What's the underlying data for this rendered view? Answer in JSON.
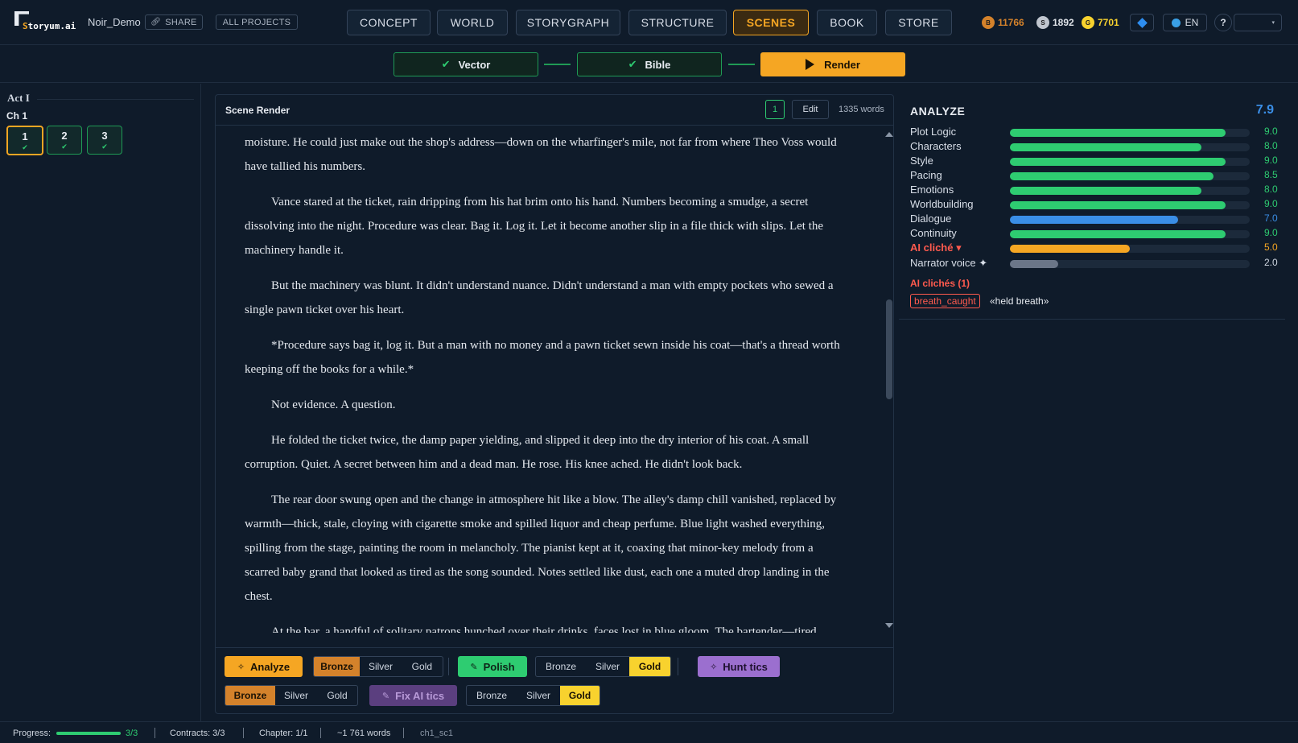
{
  "app": {
    "logo_text": "Storyum.ai",
    "project_name": "Noir_Demo",
    "share_label": "SHARE",
    "all_projects_label": "ALL PROJECTS"
  },
  "nav": {
    "tabs": [
      {
        "label": "CONCEPT",
        "active": false
      },
      {
        "label": "WORLD",
        "active": false
      },
      {
        "label": "STORYGRAPH",
        "active": false
      },
      {
        "label": "STRUCTURE",
        "active": false
      },
      {
        "label": "SCENES",
        "active": true
      },
      {
        "label": "BOOK",
        "active": false
      },
      {
        "label": "STORE",
        "active": false
      }
    ]
  },
  "wallet": {
    "bronze": {
      "symbol": "B",
      "value": "11766",
      "color": "#d4822b"
    },
    "silver": {
      "symbol": "S",
      "value": "1892",
      "color": "#c0c6cf"
    },
    "gold": {
      "symbol": "G",
      "value": "7701",
      "color": "#f8d22e"
    }
  },
  "header_controls": {
    "language": "EN",
    "help": "?"
  },
  "pipeline": {
    "steps": [
      {
        "label": "Vector",
        "status": "done"
      },
      {
        "label": "Bible",
        "status": "done"
      },
      {
        "label": "Render",
        "status": "current"
      }
    ]
  },
  "sidebar": {
    "act": "Act I",
    "chapter": "Ch 1",
    "scenes": [
      {
        "label": "1",
        "selected": true
      },
      {
        "label": "2",
        "selected": false
      },
      {
        "label": "3",
        "selected": false
      }
    ]
  },
  "editor": {
    "title": "Scene Render",
    "version": "1",
    "edit_label": "Edit",
    "word_count": "1335 words",
    "paragraphs": [
      "He opened it in his palm. A pawn ticket. The typed numbers were already feathering, blurring into pale paper from the moisture. He could just make out the shop's address—down on the wharfinger's mile, not far from where Theo Voss would have tallied his numbers.",
      "Vance stared at the ticket, rain dripping from his hat brim onto his hand. Numbers becoming a smudge, a secret dissolving into the night. Procedure was clear. Bag it. Log it. Let it become another slip in a file thick with slips. Let the machinery handle it.",
      "But the machinery was blunt. It didn't understand nuance. Didn't understand a man with empty pockets who sewed a single pawn ticket over his heart.",
      "*Procedure says bag it, log it. But a man with no money and a pawn ticket sewn inside his coat—that's a thread worth keeping off the books for a while.*",
      "Not evidence. A question.",
      "He folded the ticket twice, the damp paper yielding, and slipped it deep into the dry interior of his coat. A small corruption. Quiet. A secret between him and a dead man. He rose. His knee ached. He didn't look back.",
      "The rear door swung open and the change in atmosphere hit like a blow. The alley's damp chill vanished, replaced by warmth—thick, stale, cloying with cigarette smoke and spilled liquor and cheap perfume. Blue light washed everything, spilling from the stage, painting the room in melancholy. The pianist kept at it, coaxing that minor-key melody from a scarred baby grand that looked as tired as the song sounded. Notes settled like dust, each one a muted drop landing in the chest.",
      "At the bar, a handful of solitary patrons hunched over their drinks, faces lost in blue gloom. The bartender—tired"
    ]
  },
  "tools": {
    "analyze_label": "Analyze",
    "polish_label": "Polish",
    "hunt_tics_label": "Hunt tics",
    "fix_ai_tics_label": "Fix AI tics",
    "tier_bronze": "Bronze",
    "tier_silver": "Silver",
    "tier_gold": "Gold"
  },
  "analysis": {
    "title": "ANALYZE",
    "overall": "7.9",
    "metrics": [
      {
        "label": "Plot Logic",
        "value": "9.0",
        "score": 9.0,
        "color": "#2ecc71"
      },
      {
        "label": "Characters",
        "value": "8.0",
        "score": 8.0,
        "color": "#2ecc71"
      },
      {
        "label": "Style",
        "value": "9.0",
        "score": 9.0,
        "color": "#2ecc71"
      },
      {
        "label": "Pacing",
        "value": "8.5",
        "score": 8.5,
        "color": "#2ecc71"
      },
      {
        "label": "Emotions",
        "value": "8.0",
        "score": 8.0,
        "color": "#2ecc71"
      },
      {
        "label": "Worldbuilding",
        "value": "9.0",
        "score": 9.0,
        "color": "#2ecc71"
      },
      {
        "label": "Dialogue",
        "value": "7.0",
        "score": 7.0,
        "color": "#3a8ee6"
      },
      {
        "label": "Continuity",
        "value": "9.0",
        "score": 9.0,
        "color": "#2ecc71"
      },
      {
        "label": "AI cliché ▾",
        "value": "5.0",
        "score": 5.0,
        "color": "#f5a623",
        "warn": true
      },
      {
        "label": "Narrator voice ✦",
        "value": "2.0",
        "score": 2.0,
        "color": "#6b7688"
      }
    ],
    "cliches_title": "AI clichés (1)",
    "cliche_tag": "breath_caught",
    "cliche_phrase": "«held breath»"
  },
  "status": {
    "progress_label": "Progress:",
    "progress_value": "3/3",
    "progress_fraction": 1.0,
    "contracts": "Contracts: 3/3",
    "chapter": "Chapter: 1/1",
    "words": "~1 761 words",
    "scene_id": "ch1_sc1"
  }
}
